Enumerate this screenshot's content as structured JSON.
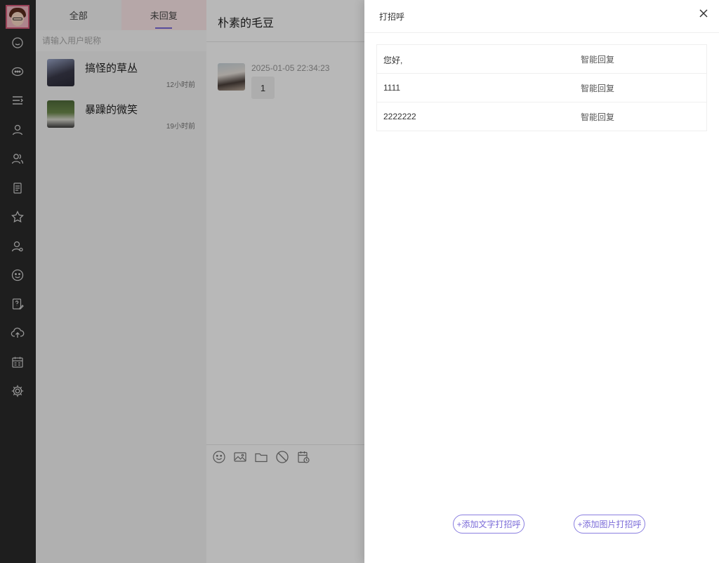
{
  "list": {
    "tabs": [
      {
        "label": "全部"
      },
      {
        "label": "未回复"
      }
    ],
    "search_placeholder": "请输入用户昵称",
    "conversations": [
      {
        "name": "搞怪的草丛",
        "time": "12小时前"
      },
      {
        "name": "暴躁的微笑",
        "time": "19小时前"
      }
    ]
  },
  "chat": {
    "title": "朴素的毛豆",
    "messages": [
      {
        "time": "2025-01-05 22:34:23",
        "text": "1"
      }
    ]
  },
  "drawer": {
    "title": "打招呼",
    "rows": [
      {
        "text": "您好,",
        "tag": "智能回复"
      },
      {
        "text": "1111",
        "tag": "智能回复"
      },
      {
        "text": "2222222",
        "tag": "智能回复"
      }
    ],
    "add_text_button": "+添加文字打招呼",
    "add_image_button": "+添加图片打招呼"
  },
  "colors": {
    "rail_bg": "#2a2a2a",
    "accent": "#7a6ad8",
    "active_tab_bg": "#fde8e9"
  },
  "icons": {
    "rail": [
      "smile-icon",
      "chat-bubble-icon",
      "list-indent-icon",
      "user-icon",
      "users-icon",
      "document-icon",
      "star-icon",
      "user-settings-icon",
      "emoji-icon",
      "help-edit-icon",
      "cloud-upload-icon",
      "calendar-icon",
      "gear-icon"
    ],
    "toolbar": [
      "emoji-icon",
      "image-icon",
      "folder-icon",
      "block-icon",
      "schedule-icon"
    ]
  }
}
